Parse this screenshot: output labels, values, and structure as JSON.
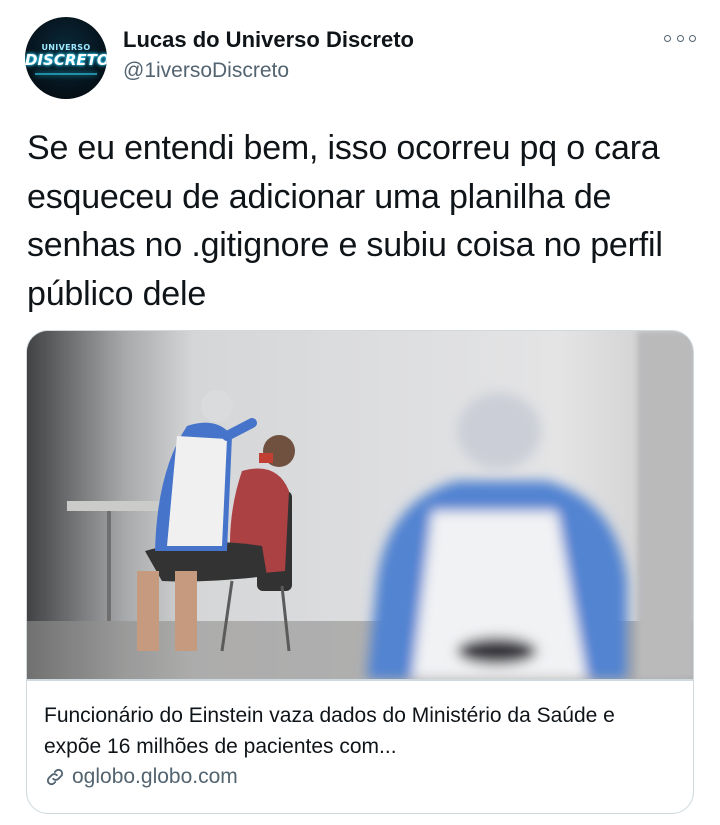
{
  "author": {
    "display_name": "Lucas do Universo Discreto",
    "handle": "@1iversoDiscreto",
    "avatar": {
      "logo_top": "UNIVERSO",
      "logo_main": "DISCRETO"
    }
  },
  "tweet": {
    "text": "Se eu entendi bem, isso ocorreu pq o cara esqueceu de adicionar uma planilha de senhas no .gitignore e subiu coisa no perfil público dele"
  },
  "link_card": {
    "title": "Funcionário do Einstein vaza dados do Ministério da Saúde e expõe 16 milhões de pacientes com...",
    "domain": "oglobo.globo.com"
  },
  "icons": {
    "more": "more-options-icon",
    "link": "link-icon"
  },
  "colors": {
    "text_primary": "#0f1419",
    "text_secondary": "#536471",
    "border": "#cfd9de",
    "ppe_blue": "#4c7fd0"
  }
}
